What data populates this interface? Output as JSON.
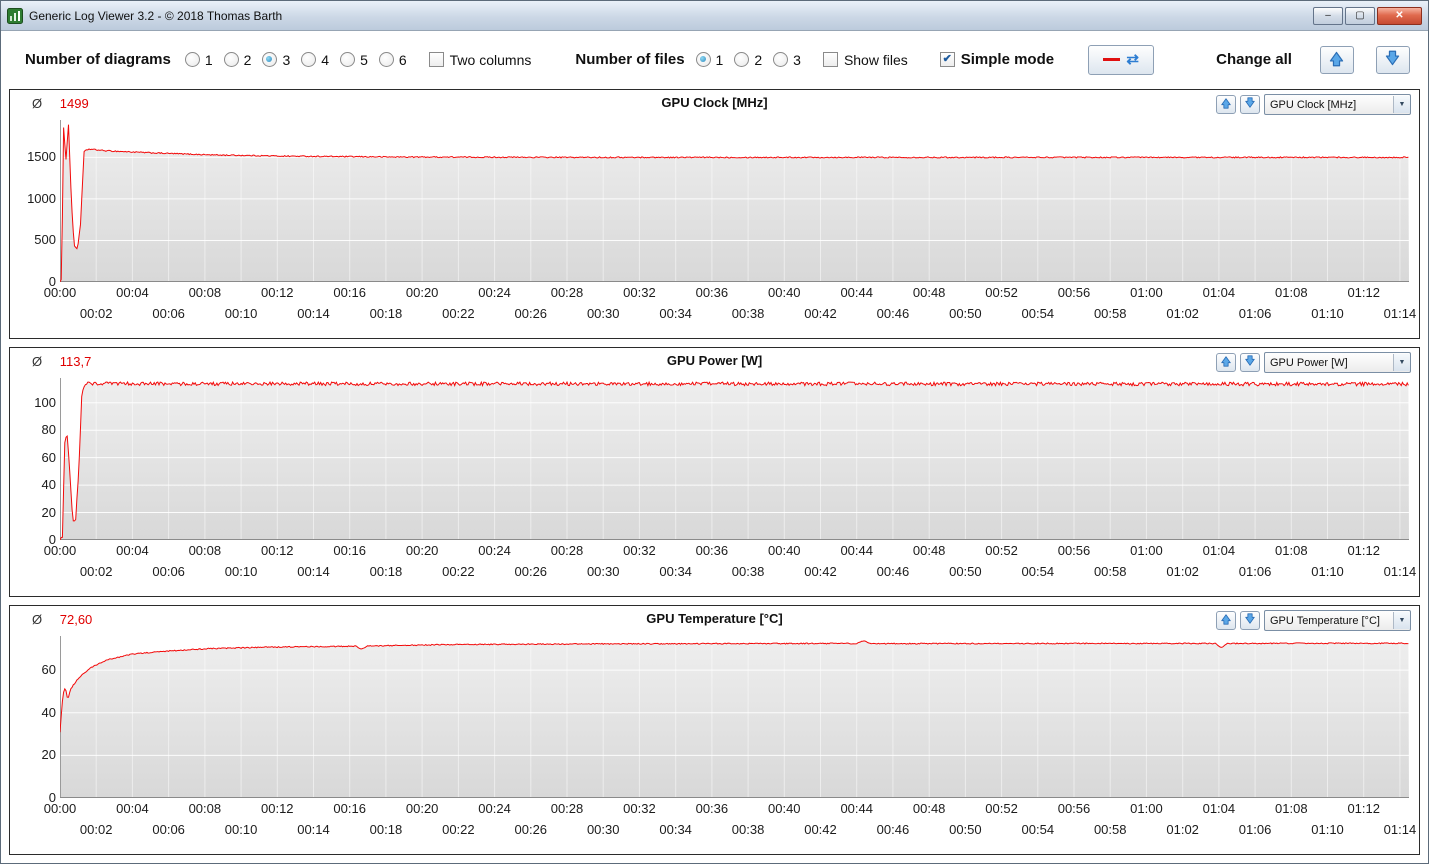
{
  "window": {
    "title": "Generic Log Viewer 3.2 - © 2018 Thomas Barth"
  },
  "icons": {
    "app_icon": "green-chart-app-icon",
    "minimize": "–",
    "maximize": "▢",
    "close": "✕",
    "dropdown_arrow": "▼",
    "check": "✔",
    "refresh": "⇄"
  },
  "toolbar": {
    "diagrams_label": "Number of diagrams",
    "diagram_options": [
      "1",
      "2",
      "3",
      "4",
      "5",
      "6"
    ],
    "diagrams_selected": "3",
    "two_columns_label": "Two columns",
    "two_columns_checked": false,
    "files_label": "Number of files",
    "file_options": [
      "1",
      "2",
      "3"
    ],
    "files_selected": "1",
    "show_files_label": "Show files",
    "show_files_checked": false,
    "simple_mode_label": "Simple mode",
    "simple_mode_checked": true,
    "change_all_label": "Change all"
  },
  "time_axis": {
    "tick_interval_seconds": 120,
    "labels": [
      "00:00",
      "00:02",
      "00:04",
      "00:06",
      "00:08",
      "00:10",
      "00:12",
      "00:14",
      "00:16",
      "00:18",
      "00:20",
      "00:22",
      "00:24",
      "00:26",
      "00:28",
      "00:30",
      "00:32",
      "00:34",
      "00:36",
      "00:38",
      "00:40",
      "00:42",
      "00:44",
      "00:46",
      "00:48",
      "00:50",
      "00:52",
      "00:54",
      "00:56",
      "00:58",
      "01:00",
      "01:02",
      "01:04",
      "01:06",
      "01:08",
      "01:10",
      "01:12",
      "01:14"
    ]
  },
  "chart_data": [
    {
      "type": "line",
      "title": "GPU Clock [MHz]",
      "avg_symbol": "Ø",
      "avg_value": "1499",
      "dropdown_value": "GPU Clock [MHz]",
      "line_color": "#f20a0a",
      "ylim": [
        0,
        1950
      ],
      "y_ticks": [
        0,
        500,
        1000,
        1500
      ],
      "xlim_seconds": [
        0,
        4470
      ],
      "keypoints_t_v": [
        [
          0,
          0
        ],
        [
          6,
          40
        ],
        [
          11,
          1900
        ],
        [
          20,
          1480
        ],
        [
          28,
          1890
        ],
        [
          38,
          950
        ],
        [
          47,
          430
        ],
        [
          58,
          400
        ],
        [
          68,
          700
        ],
        [
          80,
          1570
        ],
        [
          95,
          1600
        ],
        [
          150,
          1580
        ],
        [
          300,
          1555
        ],
        [
          500,
          1530
        ],
        [
          750,
          1515
        ],
        [
          1100,
          1505
        ],
        [
          1700,
          1500
        ],
        [
          4470,
          1500
        ]
      ],
      "noise_amplitude": 7
    },
    {
      "type": "line",
      "title": "GPU Power [W]",
      "avg_symbol": "Ø",
      "avg_value": "113,7",
      "dropdown_value": "GPU Power [W]",
      "line_color": "#f20a0a",
      "ylim": [
        0,
        118
      ],
      "y_ticks": [
        0,
        20,
        40,
        60,
        80,
        100
      ],
      "xlim_seconds": [
        0,
        4470
      ],
      "keypoints_t_v": [
        [
          0,
          0
        ],
        [
          8,
          3
        ],
        [
          16,
          72
        ],
        [
          24,
          76
        ],
        [
          34,
          45
        ],
        [
          42,
          13
        ],
        [
          52,
          15
        ],
        [
          62,
          50
        ],
        [
          72,
          105
        ],
        [
          82,
          114
        ],
        [
          300,
          113.8
        ],
        [
          4470,
          113.6
        ]
      ],
      "noise_amplitude": 1.3
    },
    {
      "type": "line",
      "title": "GPU Temperature [°C]",
      "avg_symbol": "Ø",
      "avg_value": "72,60",
      "dropdown_value": "GPU Temperature [°C]",
      "line_color": "#f20a0a",
      "ylim": [
        0,
        76
      ],
      "y_ticks": [
        0,
        20,
        40,
        60
      ],
      "xlim_seconds": [
        0,
        4470
      ],
      "keypoints_t_v": [
        [
          0,
          31
        ],
        [
          10,
          49
        ],
        [
          18,
          52
        ],
        [
          26,
          46
        ],
        [
          34,
          51
        ],
        [
          60,
          56
        ],
        [
          100,
          61
        ],
        [
          160,
          65
        ],
        [
          240,
          67.5
        ],
        [
          360,
          69
        ],
        [
          480,
          70
        ],
        [
          700,
          70.8
        ],
        [
          980,
          71.2
        ],
        [
          1000,
          69.9
        ],
        [
          1020,
          71.3
        ],
        [
          1300,
          72
        ],
        [
          1800,
          72.3
        ],
        [
          2600,
          72.5
        ],
        [
          2640,
          72.4
        ],
        [
          2660,
          73.8
        ],
        [
          2690,
          72.4
        ],
        [
          3300,
          72.5
        ],
        [
          3830,
          72.5
        ],
        [
          3848,
          70.6
        ],
        [
          3866,
          72.5
        ],
        [
          4470,
          72.6
        ]
      ],
      "noise_amplitude": 0.25
    }
  ]
}
